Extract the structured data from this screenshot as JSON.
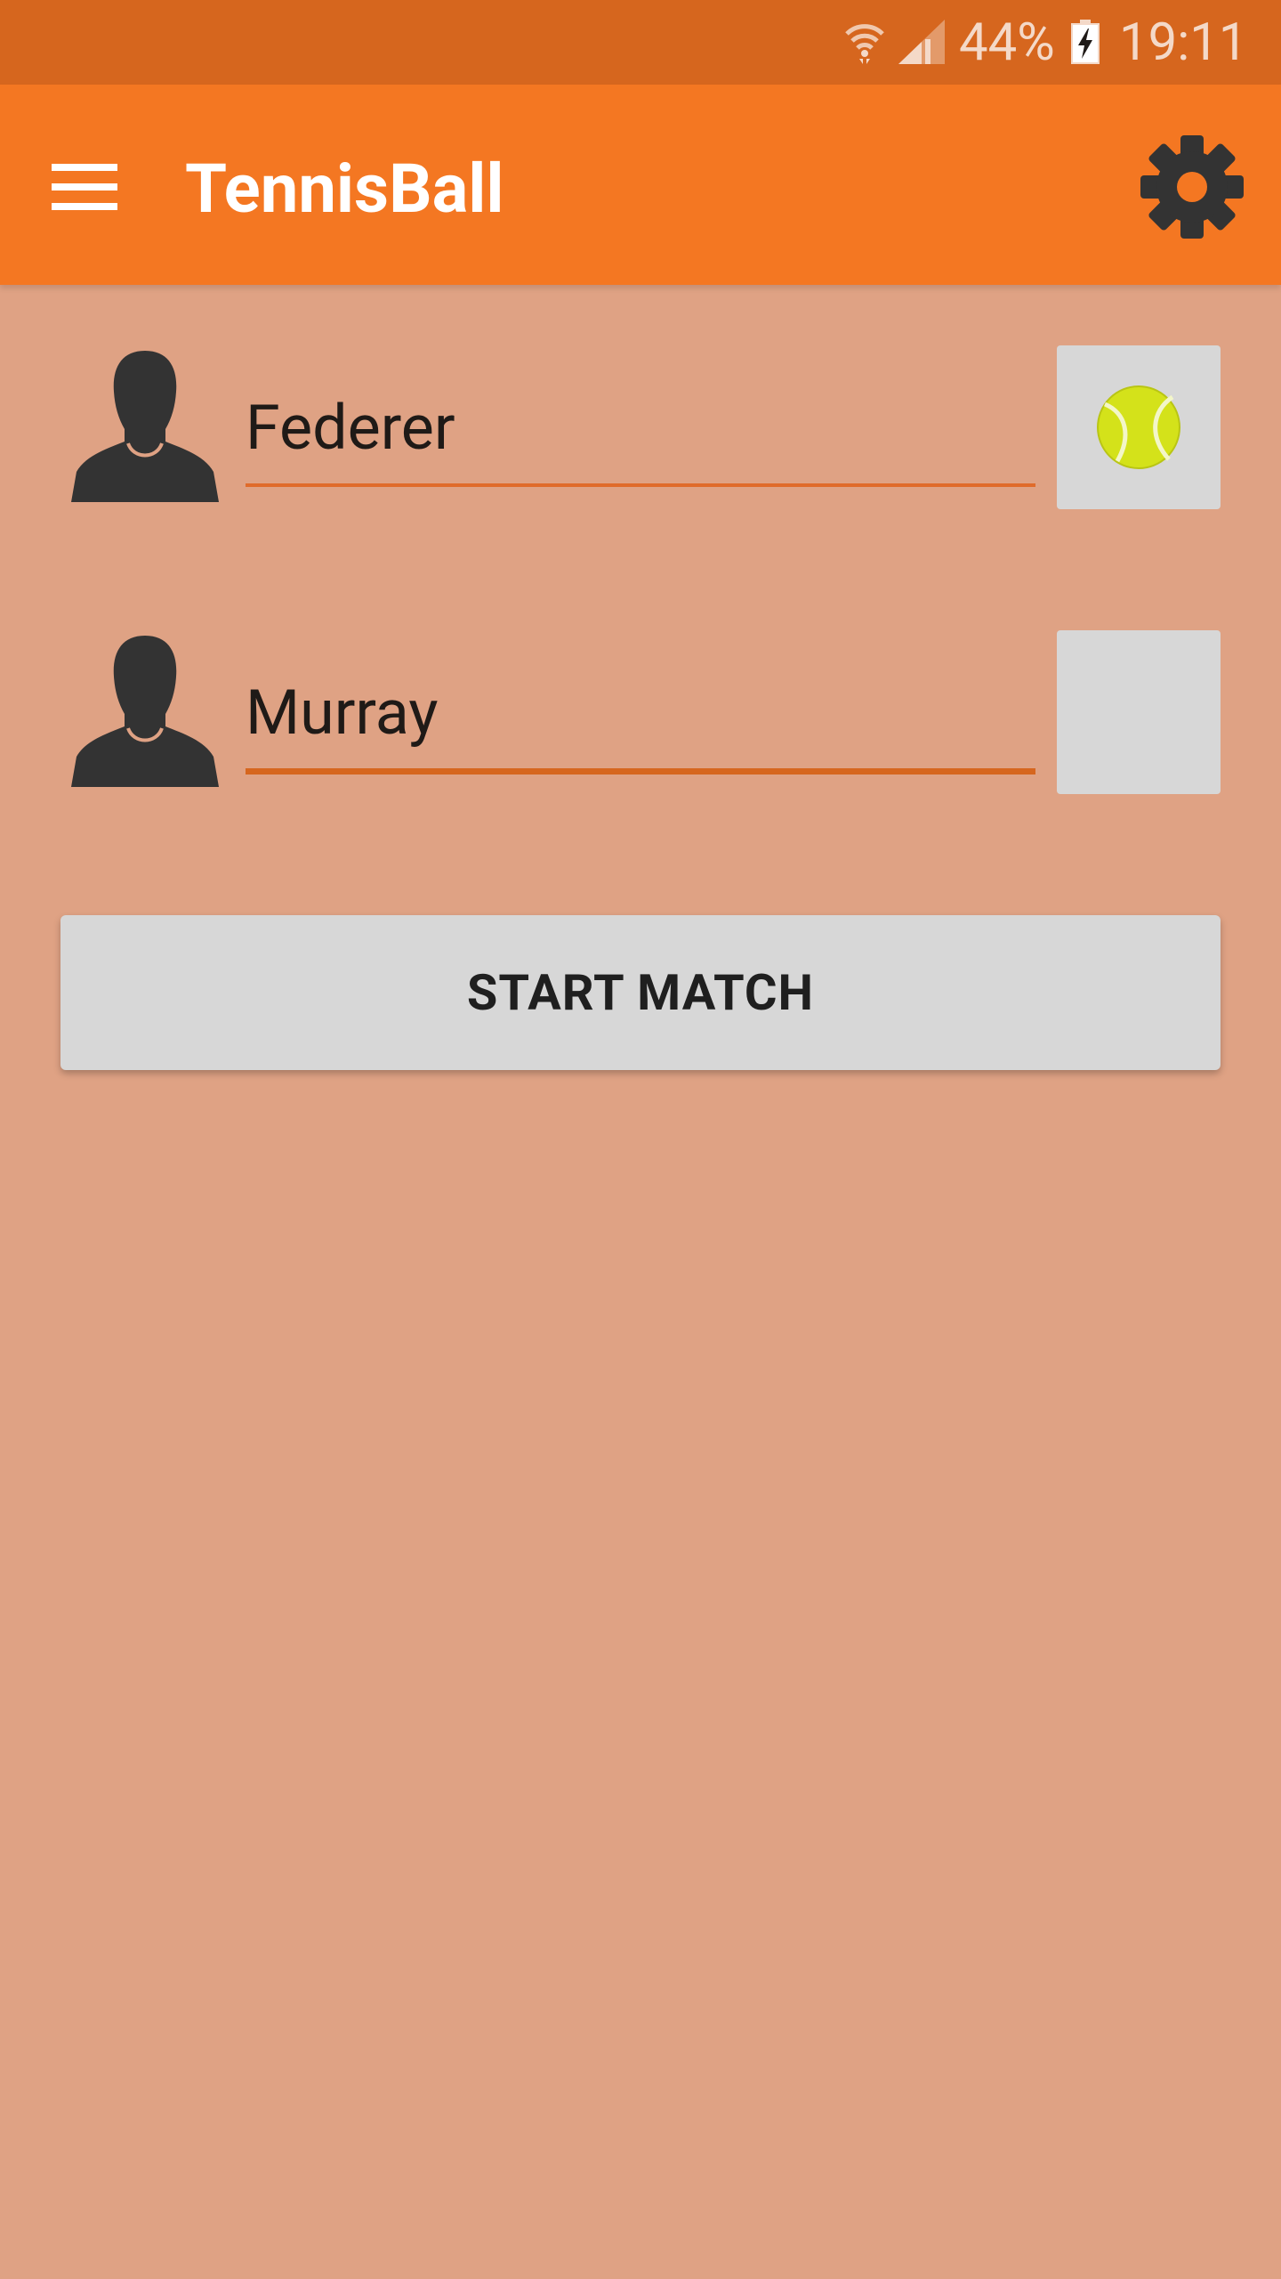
{
  "status_bar": {
    "battery_percent": "44%",
    "time": "19:11",
    "icons": [
      "wifi-icon",
      "signal-icon",
      "battery-charging-icon"
    ]
  },
  "app_bar": {
    "title": "TennisBall",
    "menu_icon": "hamburger-menu-icon",
    "settings_icon": "gear-icon"
  },
  "players": [
    {
      "name": "Federer",
      "serving": true
    },
    {
      "name": "Murray",
      "serving": false
    }
  ],
  "start_button": {
    "label": "START MATCH"
  },
  "colors": {
    "status_bar": "#D6661E",
    "app_bar": "#F47722",
    "background": "#DFA284",
    "accent": "#E06B2A",
    "box": "#D7D7D7"
  }
}
